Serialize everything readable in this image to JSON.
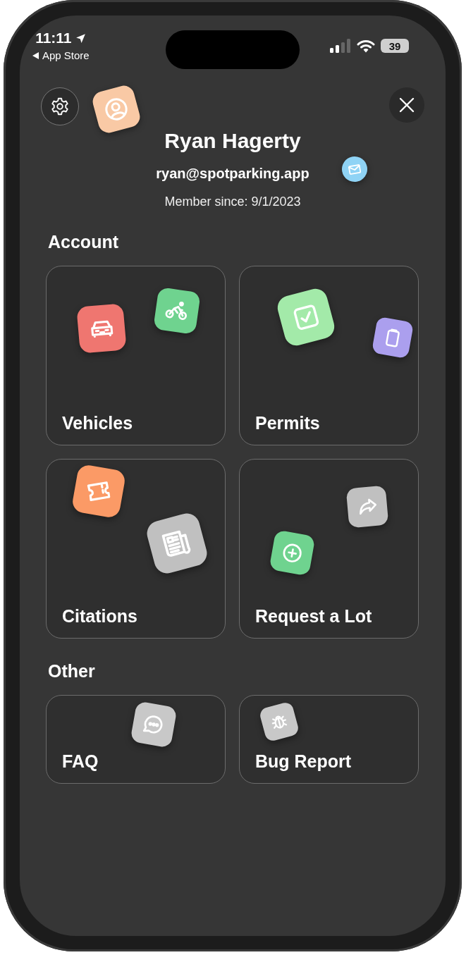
{
  "status_bar": {
    "time": "11:11",
    "back_label": "App Store",
    "battery": "39"
  },
  "profile": {
    "name": "Ryan Hagerty",
    "email": "ryan@spotparking.app",
    "member_since": "Member since: 9/1/2023"
  },
  "sections": [
    {
      "title": "Account",
      "kind": "tall",
      "cards": [
        {
          "label": "Vehicles",
          "tiles": [
            {
              "color": "#ef7670"
            },
            {
              "color": "#6fd38f"
            }
          ]
        },
        {
          "label": "Permits",
          "tiles": [
            {
              "color": "#a3eaa9"
            },
            {
              "color": "#ab9fee"
            }
          ]
        },
        {
          "label": "Citations",
          "tiles": [
            {
              "color": "#fb9a66"
            },
            {
              "color": "#c0c0c0"
            }
          ]
        },
        {
          "label": "Request a Lot",
          "tiles": [
            {
              "color": "#c0c0c0"
            },
            {
              "color": "#6fd38f"
            }
          ]
        }
      ]
    },
    {
      "title": "Other",
      "kind": "short",
      "cards": [
        {
          "label": "FAQ",
          "tiles": [
            {
              "color": "#c8c8c8"
            }
          ]
        },
        {
          "label": "Bug Report",
          "tiles": [
            {
              "color": "#c8c8c8"
            }
          ]
        }
      ]
    }
  ]
}
